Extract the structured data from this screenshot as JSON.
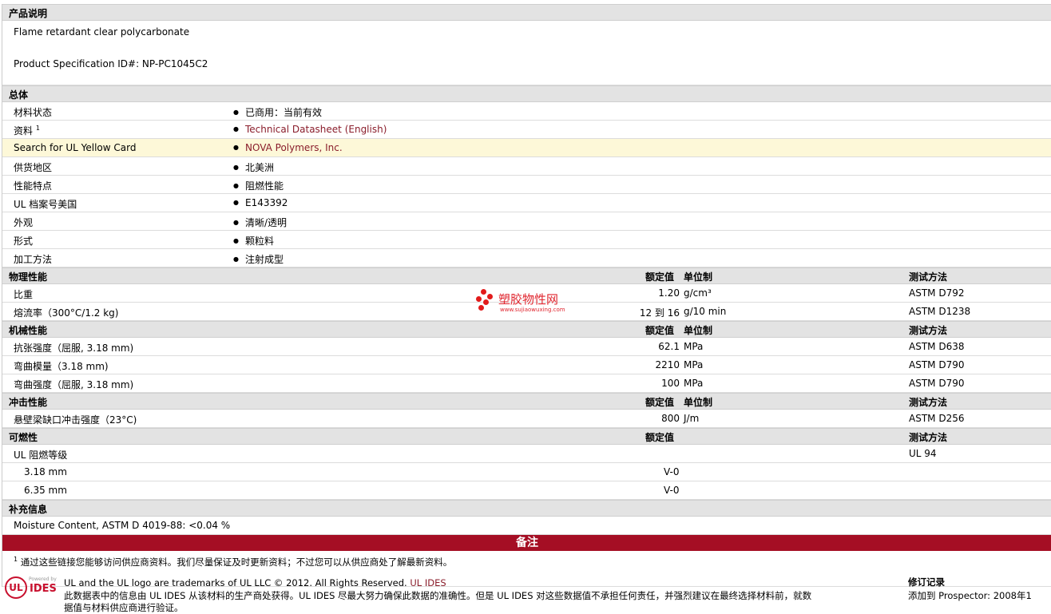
{
  "description": {
    "heading": "产品说明",
    "line1": "Flame retardant clear polycarbonate",
    "line2": "Product Specification ID#: NP-PC1045C2"
  },
  "general": {
    "heading": "总体",
    "rows": [
      {
        "label": "材料状态",
        "value": "已商用：当前有效"
      },
      {
        "label": "资料",
        "sup": "1",
        "value": "Technical Datasheet (English)"
      },
      {
        "label": "Search for UL Yellow Card",
        "value": "NOVA Polymers, Inc."
      },
      {
        "label": "供货地区",
        "value": "北美洲"
      },
      {
        "label": "性能特点",
        "value": "阻燃性能"
      },
      {
        "label": "UL 档案号美国",
        "value": "E143392"
      },
      {
        "label": "外观",
        "value": "清晰/透明"
      },
      {
        "label": "形式",
        "value": "颗粒料"
      },
      {
        "label": "加工方法",
        "value": "注射成型"
      }
    ]
  },
  "col_headers": {
    "nominal": "额定值",
    "unit": "单位制",
    "method": "测试方法"
  },
  "physical": {
    "heading": "物理性能",
    "rows": [
      {
        "label": "比重",
        "value": "1.20",
        "unit": "g/cm³",
        "method": "ASTM D792"
      },
      {
        "label": "熔流率（300°C/1.2 kg)",
        "value": "12 到 16",
        "unit": "g/10 min",
        "method": "ASTM D1238"
      }
    ]
  },
  "mechanical": {
    "heading": "机械性能",
    "rows": [
      {
        "label": "抗张强度（屈服, 3.18 mm)",
        "value": "62.1",
        "unit": "MPa",
        "method": "ASTM D638"
      },
      {
        "label": "弯曲模量（3.18 mm)",
        "value": "2210",
        "unit": "MPa",
        "method": "ASTM D790"
      },
      {
        "label": "弯曲强度（屈服, 3.18 mm)",
        "value": "100",
        "unit": "MPa",
        "method": "ASTM D790"
      }
    ]
  },
  "impact": {
    "heading": "冲击性能",
    "rows": [
      {
        "label": "悬壁梁缺口冲击强度（23°C)",
        "value": "800",
        "unit": "J/m",
        "method": "ASTM D256"
      }
    ]
  },
  "flammability": {
    "heading": "可燃性",
    "rows": [
      {
        "label": "UL 阻燃等级",
        "value": "",
        "method": "UL 94"
      },
      {
        "label": "3.18 mm",
        "value": "V-0",
        "method": ""
      },
      {
        "label": "6.35 mm",
        "value": "V-0",
        "method": ""
      }
    ]
  },
  "supplemental": {
    "heading": "补充信息",
    "text": "Moisture Content, ASTM D 4019-88: <0.04 %"
  },
  "notes": {
    "banner": "备注",
    "sup": "1",
    "text": "通过这些链接您能够访问供应商资料。我们尽量保证及时更新资料；不过您可以从供应商处了解最新资料。"
  },
  "footer": {
    "logo": "UL",
    "ides": "IDES",
    "powered": "Powered by",
    "trademark": "UL and the UL logo are trademarks of UL LLC © 2012. All Rights Reserved.",
    "trademark_link": "UL IDES",
    "disclaimer": "此数据表中的信息由 UL IDES 从该材料的生产商处获得。UL IDES 尽最大努力确保此数据的准确性。但是 UL IDES 对这些数据值不承担任何责任，并强烈建议在最终选择材料前，就数",
    "disclaimer2": "据值与材料供应商进行验证。",
    "revision_title": "修订记录",
    "revision_added": "添加到 Prospector: 2008年1"
  },
  "watermark": {
    "cn": "塑胶物性网",
    "url": "www.sujiaowuxing.com"
  }
}
